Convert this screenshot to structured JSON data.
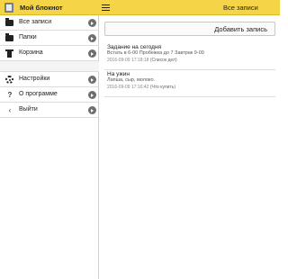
{
  "header": {
    "app_title": "Мой блокнот",
    "page_title": "Все записи",
    "color": "#f5d547"
  },
  "sidebar": {
    "items": [
      {
        "label": "Все записи",
        "icon": "folder-icon"
      },
      {
        "label": "Папки",
        "icon": "folder-icon"
      },
      {
        "label": "Корзина",
        "icon": "trash-icon"
      },
      {
        "label": "Настройки",
        "icon": "gear-icon"
      },
      {
        "label": "О программе",
        "icon": "question-icon"
      },
      {
        "label": "Выйти",
        "icon": "back-arrow-icon"
      }
    ]
  },
  "main": {
    "add_button_label": "Добавить запись",
    "notes": [
      {
        "title": "Задание на сегодня",
        "body": "Встать в 6-00 Пробежка до 7 Завтрак 9-00",
        "timestamp": "2016-09-09 17:18:18",
        "folder": "(Список дел)"
      },
      {
        "title": "На ужин",
        "body": "Лапша, сыр, молоко.",
        "timestamp": "2016-09-09 17:16:42",
        "folder": "(Что купить)"
      }
    ]
  }
}
